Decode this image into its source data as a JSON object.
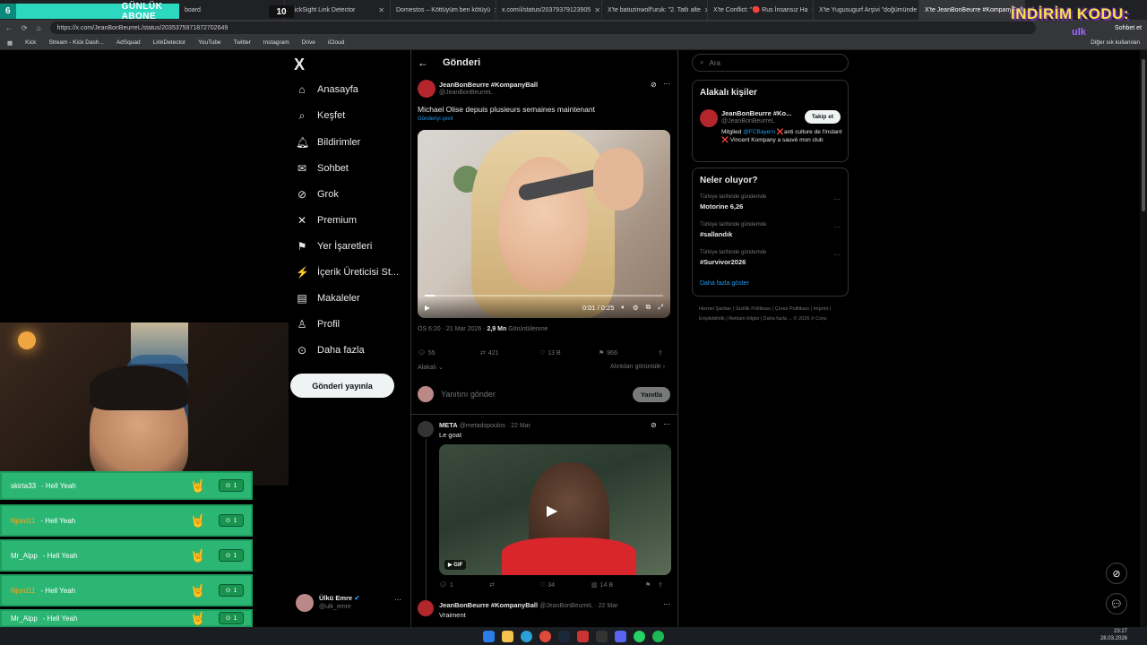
{
  "browser": {
    "tabs": [
      {
        "label": "board"
      },
      {
        "label": "KickSight Link Detector"
      },
      {
        "label": "Domestos – Köttüyüm ben kötüyü"
      },
      {
        "label": "x.com/i/status/20379379123905"
      },
      {
        "label": "X'te batuzinwolf'uruk: \"2. Tatlı alte"
      },
      {
        "label": "X'te Conflict: \"🔴 Rus İnsansız Ha"
      },
      {
        "label": "X'te Yugusugurf Arşivi \"doğümünde"
      },
      {
        "label": "X'te JeanBonBeurre #KompanyBall",
        "active": true
      }
    ],
    "url": "https://x.com/JeanBonBeurreL/status/2035375971872702649",
    "bookmarks": [
      "Kick",
      "Stream - Kick Dash...",
      "AdSquad",
      "LinkDetector",
      "YouTube",
      "Twitter",
      "Instagram",
      "Drive",
      "iCloud"
    ],
    "other_bookmarks": "Diğer sık kullanılan",
    "chat_label": "Sohbet et"
  },
  "overlay": {
    "sub_banner_num": "6",
    "sub_banner_label": "GÜNLÜK ABONE",
    "sub_count": "10",
    "promo_line1": "İNDİRİM KODU:",
    "promo_line2": "ulk"
  },
  "nav": {
    "logo": "X",
    "items": [
      "Anasayfa",
      "Keşfet",
      "Bildirimler",
      "Sohbet",
      "Grok",
      "Premium",
      "Yer İşaretleri",
      "İçerik Üreticisi St...",
      "Makaleler",
      "Profil",
      "Daha fazla"
    ],
    "post_button": "Gönderi yayınla",
    "account_name": "Ülkü Emre",
    "account_handle": "@ulk_emre"
  },
  "post": {
    "header": "Gönderi",
    "author": "JeanBonBeurre #KompanyBall",
    "handle": "@JeanBonBeurreL",
    "text": "Michael Olise depuis plusieurs semaines maintenant",
    "translate": "Gönderiyi çevir",
    "video_time": "0:01 / 0:25",
    "progress_fraction": 0.04,
    "timestamp": "ÖS 6:20 · 21 Mar 2026 ·",
    "views": "2,9 Mn",
    "views_label": "Görüntülenme",
    "replies": "55",
    "reposts": "421",
    "likes": "13 B",
    "bookmarks": "966",
    "related_label": "Alakalı",
    "quotes_label": "Alıntıları görüntüle",
    "reply_placeholder": "Yanıtını gönder",
    "reply_button": "Yanıtla"
  },
  "reply1": {
    "author": "META",
    "handle": "@metadopoulos · 22 Mar",
    "text": "Le goat",
    "gif_label": "GIF",
    "replies": "1",
    "likes": "34",
    "views": "14 B"
  },
  "reply2": {
    "author": "JeanBonBeurre #KompanyBall",
    "handle": "@JeanBonBeurreL · 22 Mar",
    "text": "Vraiment"
  },
  "right": {
    "search_placeholder": "Ara",
    "people_title": "Alakalı kişiler",
    "person_name": "JeanBonBeurre #Ko...",
    "person_handle": "@JeanBonBeurreL",
    "follow_label": "Takip et",
    "bio_prefix": "Mitglied ",
    "bio_link": "@FCBayern",
    "bio_rest": " ❌anti culture de l'instant ❌ Vincent Kompany a sauvé mon club",
    "trends_title": "Neler oluyor?",
    "trends": [
      {
        "context": "Türkiye tarihinde gündemde",
        "topic": "Motorine 6,26"
      },
      {
        "context": "Türkiye tarihinde gündemde",
        "topic": "#sallandık"
      },
      {
        "context": "Türkiye tarihinde gündemde",
        "topic": "#Survivor2026"
      }
    ],
    "show_more": "Daha fazla göster",
    "footer": "Hizmet Şartları | Gizlilik Politikası | Çerez Politikası | Imprint | Erişilebilirlik | Reklam bilgisi | Daha fazla ... © 2026 X Corp."
  },
  "alerts": [
    {
      "user": "skirta33",
      "msg": "- Hell Yeah",
      "count": "1",
      "orange": false
    },
    {
      "user": "Njord11",
      "msg": "- Hell Yeah",
      "count": "1",
      "orange": true
    },
    {
      "user": "Mr_Alpp",
      "msg": "- Hell Yeah",
      "count": "1",
      "orange": false
    },
    {
      "user": "Njord11",
      "msg": "- Hell Yeah",
      "count": "1",
      "orange": true
    },
    {
      "user": "Mr_Alpp",
      "msg": "- Hell Yeah",
      "count": "1",
      "orange": false
    }
  ],
  "taskbar": {
    "time": "23:27",
    "date": "28.03.2026"
  }
}
